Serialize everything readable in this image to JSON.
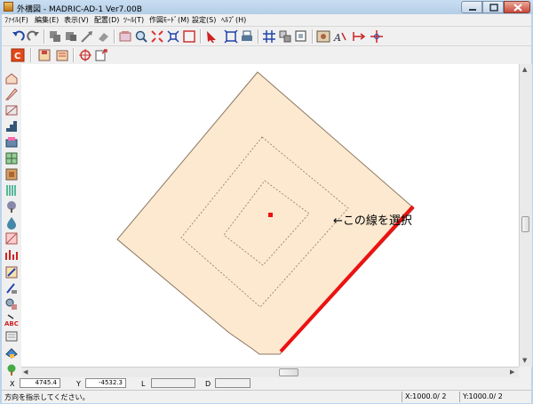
{
  "window": {
    "title": "外構図 - MADRIC-AD-1 Ver7.00B"
  },
  "menu": [
    "ﾌｧｲﾙ(F)",
    "編集(E)",
    "表示(V)",
    "配置(D)",
    "ﾂｰﾙ(T)",
    "作図ﾓｰﾄﾞ(M)",
    "設定(S)",
    "ﾍﾙﾌﾟ(H)"
  ],
  "toolbar1": [
    "undo-icon",
    "redo-icon",
    "copy-shape-icon",
    "move-shape-icon",
    "arrow-line-icon",
    "eraser-icon",
    "select-window-icon",
    "zoom-icon",
    "zoom-extents-icon",
    "zoom-window-icon",
    "rectangle-icon",
    "pointer-icon",
    "fit-view-icon",
    "print-icon",
    "grid-snap-icon",
    "layer-icon",
    "clip-icon",
    "image-icon",
    "text-style-icon",
    "dimension-icon",
    "origin-icon"
  ],
  "toolbar2": [
    "cad-mode-icon",
    "save-icon",
    "open-icon",
    "target-icon",
    "export-icon"
  ],
  "left_toolbar": [
    "house-tool-icon",
    "fence-tool-icon",
    "wall-tool-icon",
    "stairs-tool-icon",
    "gate-tool-icon",
    "paving-tool-icon",
    "block-tool-icon",
    "column-tool-icon",
    "tree-tool-icon",
    "water-tool-icon",
    "hatch-tool-icon",
    "chart-tool-icon",
    "edit-tool-icon",
    "text-tool-icon",
    "abc-text-icon",
    "parts-tool-icon",
    "car-tool-icon",
    "plant-tool-icon"
  ],
  "drawing": {
    "annotation": "←この線を選択",
    "highlight_color": "#ee1111",
    "fill_color": "#fde9d0",
    "outline_color": "#8a7760"
  },
  "coords": {
    "x_label": "X",
    "x_value": "4745.4",
    "y_label": "Y",
    "y_value": "-4532.3",
    "l_label": "L",
    "l_value": "",
    "d_label": "D",
    "d_value": ""
  },
  "status": {
    "message": "方向を指示してください。",
    "panel_x": "X:1000.0/ 2",
    "panel_y": "Y:1000.0/ 2"
  }
}
